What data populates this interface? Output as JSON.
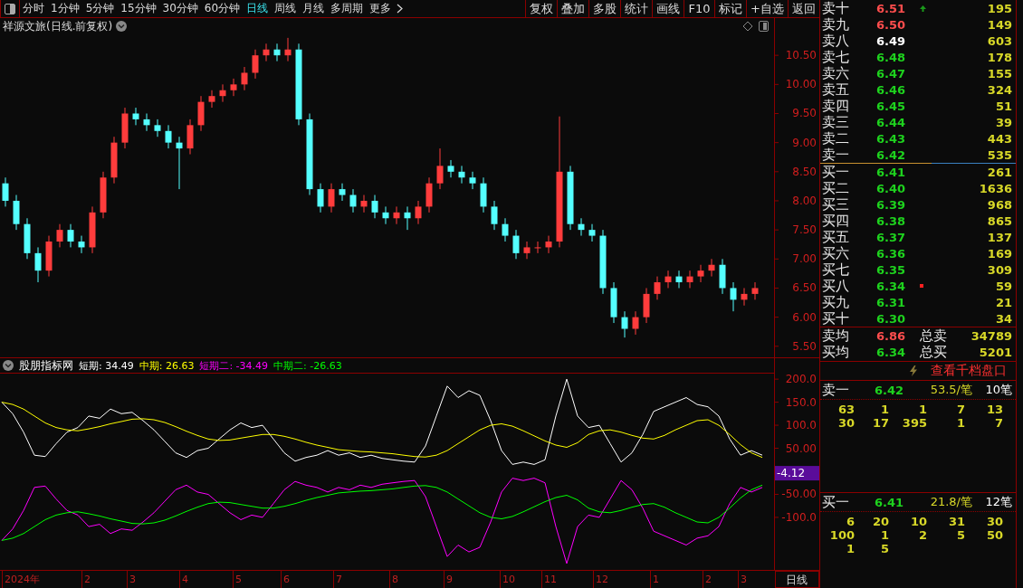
{
  "toolbar": {
    "periods": [
      {
        "label": "分时",
        "selected": false
      },
      {
        "label": "1分钟",
        "selected": false
      },
      {
        "label": "5分钟",
        "selected": false
      },
      {
        "label": "15分钟",
        "selected": false
      },
      {
        "label": "30分钟",
        "selected": false
      },
      {
        "label": "60分钟",
        "selected": false
      },
      {
        "label": "日线",
        "selected": true
      },
      {
        "label": "周线",
        "selected": false
      },
      {
        "label": "月线",
        "selected": false
      },
      {
        "label": "多周期",
        "selected": false
      },
      {
        "label": "更多",
        "selected": false
      }
    ],
    "buttons": [
      "复权",
      "叠加",
      "多股",
      "统计",
      "画线",
      "F10",
      "标记",
      "+自选",
      "返回"
    ]
  },
  "chart": {
    "title": "祥源文旅(日线.前复权)",
    "chart_data": {
      "type": "candlestick",
      "ylim": [
        5.31,
        11.14
      ],
      "ohlc": [
        [
          8.3,
          8.4,
          7.9,
          8.0
        ],
        [
          8.0,
          8.1,
          7.5,
          7.6
        ],
        [
          7.6,
          7.7,
          7.0,
          7.1
        ],
        [
          7.1,
          7.2,
          6.6,
          6.8
        ],
        [
          6.8,
          7.4,
          6.7,
          7.3
        ],
        [
          7.3,
          7.6,
          7.2,
          7.5
        ],
        [
          7.5,
          7.6,
          7.2,
          7.3
        ],
        [
          7.3,
          7.4,
          7.1,
          7.2
        ],
        [
          7.2,
          7.9,
          7.1,
          7.8
        ],
        [
          7.8,
          8.5,
          7.7,
          8.4
        ],
        [
          8.4,
          9.1,
          8.3,
          9.0
        ],
        [
          9.0,
          9.6,
          8.9,
          9.5
        ],
        [
          9.5,
          9.6,
          9.3,
          9.4
        ],
        [
          9.4,
          9.5,
          9.2,
          9.3
        ],
        [
          9.3,
          9.4,
          9.1,
          9.2
        ],
        [
          9.2,
          9.3,
          8.9,
          9.0
        ],
        [
          9.0,
          9.1,
          8.2,
          8.9
        ],
        [
          8.9,
          9.4,
          8.8,
          9.3
        ],
        [
          9.3,
          9.8,
          9.2,
          9.7
        ],
        [
          9.7,
          9.9,
          9.6,
          9.8
        ],
        [
          9.8,
          10.0,
          9.7,
          9.9
        ],
        [
          9.9,
          10.1,
          9.8,
          10.0
        ],
        [
          10.0,
          10.3,
          9.9,
          10.2
        ],
        [
          10.2,
          10.6,
          10.1,
          10.5
        ],
        [
          10.5,
          10.7,
          10.4,
          10.6
        ],
        [
          10.6,
          10.7,
          10.4,
          10.5
        ],
        [
          10.5,
          10.8,
          10.4,
          10.6
        ],
        [
          10.6,
          10.7,
          9.3,
          9.4
        ],
        [
          9.4,
          9.5,
          8.1,
          8.2
        ],
        [
          8.2,
          8.3,
          7.8,
          7.9
        ],
        [
          7.9,
          8.3,
          7.8,
          8.2
        ],
        [
          8.2,
          8.3,
          8.0,
          8.1
        ],
        [
          8.1,
          8.2,
          7.8,
          7.9
        ],
        [
          7.9,
          8.1,
          7.8,
          8.0
        ],
        [
          8.0,
          8.1,
          7.7,
          7.8
        ],
        [
          7.8,
          7.9,
          7.6,
          7.7
        ],
        [
          7.7,
          7.9,
          7.6,
          7.8
        ],
        [
          7.8,
          7.9,
          7.5,
          7.7
        ],
        [
          7.7,
          8.0,
          7.6,
          7.9
        ],
        [
          7.9,
          8.4,
          7.8,
          8.3
        ],
        [
          8.3,
          8.9,
          8.2,
          8.6
        ],
        [
          8.6,
          8.7,
          8.4,
          8.5
        ],
        [
          8.5,
          8.6,
          8.3,
          8.4
        ],
        [
          8.4,
          8.5,
          8.2,
          8.3
        ],
        [
          8.3,
          8.4,
          7.8,
          7.9
        ],
        [
          7.9,
          8.0,
          7.5,
          7.6
        ],
        [
          7.6,
          7.7,
          7.3,
          7.4
        ],
        [
          7.4,
          7.5,
          7.0,
          7.1
        ],
        [
          7.1,
          7.3,
          7.0,
          7.2
        ],
        [
          7.2,
          7.3,
          7.1,
          7.2
        ],
        [
          7.2,
          7.4,
          7.1,
          7.3
        ],
        [
          7.3,
          9.45,
          7.2,
          8.5
        ],
        [
          8.5,
          8.6,
          7.5,
          7.6
        ],
        [
          7.6,
          7.7,
          7.4,
          7.5
        ],
        [
          7.5,
          7.6,
          7.3,
          7.4
        ],
        [
          7.4,
          7.5,
          6.4,
          6.5
        ],
        [
          6.5,
          6.6,
          5.9,
          6.0
        ],
        [
          6.0,
          6.1,
          5.65,
          5.8
        ],
        [
          5.8,
          6.1,
          5.7,
          6.0
        ],
        [
          6.0,
          6.5,
          5.9,
          6.4
        ],
        [
          6.4,
          6.7,
          6.3,
          6.6
        ],
        [
          6.6,
          6.8,
          6.5,
          6.7
        ],
        [
          6.7,
          6.8,
          6.5,
          6.6
        ],
        [
          6.6,
          6.8,
          6.5,
          6.7
        ],
        [
          6.7,
          6.9,
          6.6,
          6.8
        ],
        [
          6.8,
          7.0,
          6.7,
          6.9
        ],
        [
          6.9,
          7.0,
          6.4,
          6.5
        ],
        [
          6.5,
          6.6,
          6.1,
          6.3
        ],
        [
          6.3,
          6.5,
          6.2,
          6.4
        ],
        [
          6.4,
          6.6,
          6.3,
          6.5
        ]
      ],
      "yticks": [
        {
          "value": 10.5,
          "label": "10.50"
        },
        {
          "value": 10,
          "label": "10.00"
        },
        {
          "value": 9.5,
          "label": "9.50"
        },
        {
          "value": 9,
          "label": "9.00"
        },
        {
          "value": 8.5,
          "label": "8.50"
        },
        {
          "value": 8,
          "label": "8.00"
        },
        {
          "value": 7.5,
          "label": "7.50"
        },
        {
          "value": 7,
          "label": "7.00"
        },
        {
          "value": 6.5,
          "label": "6.50"
        },
        {
          "value": 6,
          "label": "6.00"
        },
        {
          "value": 5.5,
          "label": "5.50"
        }
      ]
    },
    "indicator": {
      "name": "股朋指标网",
      "legend": [
        {
          "value": ": 34.49"
        },
        {
          "value": ": 26.63"
        },
        {
          "value": ": -34.49"
        },
        {
          "value": ": -26.63"
        }
      ],
      "chart_data": {
        "type": "line",
        "ylim": [
          -214,
          214
        ],
        "yticks": [
          {
            "value": 200,
            "label": "200.0"
          },
          {
            "value": 150,
            "label": "150.0"
          },
          {
            "value": 100,
            "label": "100.0"
          },
          {
            "value": 50,
            "label": "50.00"
          },
          {
            "value": -50,
            "label": "-50.00"
          },
          {
            "value": -100,
            "label": "-100.0"
          }
        ],
        "series": [
          {
            "name": "短期",
            "color": "#ffffff",
            "values": [
              150,
              125,
              85,
              35,
              32,
              60,
              85,
              95,
              120,
              115,
              135,
              125,
              128,
              110,
              90,
              65,
              40,
              30,
              45,
              50,
              70,
              90,
              105,
              95,
              100,
              70,
              40,
              22,
              30,
              35,
              45,
              35,
              40,
              30,
              35,
              28,
              25,
              22,
              20,
              55,
              120,
              185,
              160,
              175,
              165,
              110,
              45,
              15,
              20,
              15,
              25,
              120,
              200,
              120,
              95,
              100,
              60,
              20,
              40,
              80,
              130,
              140,
              150,
              160,
              145,
              140,
              120,
              70,
              35,
              45,
              35
            ]
          },
          {
            "name": "中期",
            "color": "#ffff00",
            "values": [
              150,
              145,
              135,
              120,
              105,
              95,
              90,
              88,
              92,
              97,
              103,
              108,
              113,
              114,
              112,
              106,
              97,
              87,
              78,
              70,
              67,
              68,
              72,
              76,
              80,
              80,
              76,
              70,
              63,
              57,
              52,
              47,
              45,
              43,
              42,
              40,
              38,
              35,
              32,
              31,
              35,
              45,
              60,
              75,
              90,
              100,
              103,
              98,
              88,
              77,
              66,
              57,
              52,
              62,
              80,
              88,
              90,
              85,
              78,
              72,
              70,
              78,
              90,
              100,
              110,
              112,
              100,
              80,
              58,
              40,
              30
            ]
          },
          {
            "name": "短期二",
            "color": "#ff00ff",
            "values": [
              -150,
              -125,
              -85,
              -35,
              -32,
              -60,
              -85,
              -95,
              -120,
              -115,
              -135,
              -125,
              -128,
              -110,
              -90,
              -65,
              -40,
              -30,
              -45,
              -50,
              -70,
              -90,
              -105,
              -95,
              -100,
              -70,
              -40,
              -22,
              -30,
              -35,
              -45,
              -35,
              -40,
              -30,
              -35,
              -28,
              -25,
              -22,
              -20,
              -55,
              -120,
              -185,
              -160,
              -175,
              -165,
              -110,
              -45,
              -15,
              -20,
              -15,
              -25,
              -120,
              -200,
              -120,
              -95,
              -100,
              -60,
              -20,
              -40,
              -80,
              -130,
              -140,
              -150,
              -160,
              -145,
              -140,
              -120,
              -70,
              -35,
              -45,
              -35
            ]
          },
          {
            "name": "中期二",
            "color": "#00ff00",
            "values": [
              -150,
              -145,
              -135,
              -120,
              -105,
              -95,
              -90,
              -88,
              -92,
              -97,
              -103,
              -108,
              -113,
              -114,
              -112,
              -106,
              -97,
              -87,
              -78,
              -70,
              -67,
              -68,
              -72,
              -76,
              -80,
              -80,
              -76,
              -70,
              -63,
              -57,
              -52,
              -47,
              -45,
              -43,
              -42,
              -40,
              -38,
              -35,
              -32,
              -31,
              -35,
              -45,
              -60,
              -75,
              -90,
              -100,
              -103,
              -98,
              -88,
              -77,
              -66,
              -57,
              -52,
              -62,
              -80,
              -88,
              -90,
              -85,
              -78,
              -72,
              -70,
              -78,
              -90,
              -100,
              -110,
              -112,
              -100,
              -80,
              -58,
              -40,
              -30
            ]
          }
        ]
      },
      "current": "-4.12"
    },
    "dates": [
      "2024年",
      "2",
      "3",
      "4",
      "5",
      "6",
      "7",
      "8",
      "9",
      "10",
      "11",
      "12",
      "1",
      "2",
      "3"
    ],
    "period": "日线"
  },
  "order_book": {
    "asks": [
      {
        "label": "卖十",
        "price": "6.51",
        "color": "#ff4d4d",
        "volume": "195",
        "uptick": true,
        "flagged": false
      },
      {
        "label": "卖九",
        "price": "6.50",
        "color": "#ff4d4d",
        "volume": "149",
        "uptick": false,
        "flagged": false
      },
      {
        "label": "卖八",
        "price": "6.49",
        "color": "#ffffff",
        "volume": "603",
        "uptick": false,
        "flagged": false
      },
      {
        "label": "卖七",
        "price": "6.48",
        "color": "#1ed21e",
        "volume": "178",
        "uptick": false,
        "flagged": false
      },
      {
        "label": "卖六",
        "price": "6.47",
        "color": "#1ed21e",
        "volume": "155",
        "uptick": false,
        "flagged": false
      },
      {
        "label": "卖五",
        "price": "6.46",
        "color": "#1ed21e",
        "volume": "324",
        "uptick": false,
        "flagged": false
      },
      {
        "label": "卖四",
        "price": "6.45",
        "color": "#1ed21e",
        "volume": "51",
        "uptick": false,
        "flagged": false
      },
      {
        "label": "卖三",
        "price": "6.44",
        "color": "#1ed21e",
        "volume": "39",
        "uptick": false,
        "flagged": false
      },
      {
        "label": "卖二",
        "price": "6.43",
        "color": "#1ed21e",
        "volume": "443",
        "uptick": false,
        "flagged": false
      },
      {
        "label": "卖一",
        "price": "6.42",
        "color": "#1ed21e",
        "volume": "535",
        "uptick": false,
        "flagged": false
      }
    ],
    "bids": [
      {
        "label": "买一",
        "price": "6.41",
        "color": "#1ed21e",
        "volume": "261",
        "uptick": false,
        "flagged": false
      },
      {
        "label": "买二",
        "price": "6.40",
        "color": "#1ed21e",
        "volume": "1636",
        "uptick": false,
        "flagged": false
      },
      {
        "label": "买三",
        "price": "6.39",
        "color": "#1ed21e",
        "volume": "968",
        "uptick": false,
        "flagged": false
      },
      {
        "label": "买四",
        "price": "6.38",
        "color": "#1ed21e",
        "volume": "865",
        "uptick": false,
        "flagged": false
      },
      {
        "label": "买五",
        "price": "6.37",
        "color": "#1ed21e",
        "volume": "137",
        "uptick": false,
        "flagged": false
      },
      {
        "label": "买六",
        "price": "6.36",
        "color": "#1ed21e",
        "volume": "169",
        "uptick": false,
        "flagged": false
      },
      {
        "label": "买七",
        "price": "6.35",
        "color": "#1ed21e",
        "volume": "309",
        "uptick": false,
        "flagged": false
      },
      {
        "label": "买八",
        "price": "6.34",
        "color": "#1ed21e",
        "volume": "59",
        "uptick": false,
        "flagged": true
      },
      {
        "label": "买九",
        "price": "6.31",
        "color": "#1ed21e",
        "volume": "21",
        "uptick": false,
        "flagged": false
      },
      {
        "label": "买十",
        "price": "6.30",
        "color": "#1ed21e",
        "volume": "34",
        "uptick": false,
        "flagged": false
      }
    ],
    "summary": [
      {
        "label": "卖均",
        "price": "6.86",
        "color": "#ff4d4d",
        "total_label": "总卖",
        "total": "34789"
      },
      {
        "label": "买均",
        "price": "6.34",
        "color": "#1ed21e",
        "total_label": "总买",
        "total": "5201"
      }
    ],
    "depth_link": "查看千档盘口",
    "best": [
      {
        "label": "卖一",
        "price": "6.42",
        "color": "#1ed21e",
        "avg": "53.5/笔",
        "count": "10笔",
        "orders": [
          "63",
          "1",
          "1",
          "7",
          "13",
          "30",
          "17",
          "395",
          "1",
          "7"
        ]
      },
      {
        "label": "买一",
        "price": "6.41",
        "color": "#1ed21e",
        "avg": "21.8/笔",
        "count": "12笔",
        "orders": [
          "6",
          "20",
          "10",
          "31",
          "30",
          "100",
          "1",
          "2",
          "5",
          "50",
          "1",
          "5"
        ]
      }
    ]
  }
}
